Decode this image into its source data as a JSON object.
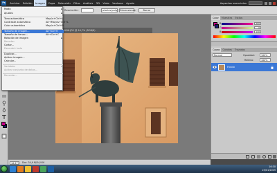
{
  "menubar": {
    "items": [
      "Archivo",
      "Edición",
      "Imagen",
      "Capa",
      "Selección",
      "Filtro",
      "Análisis",
      "3D",
      "Vista",
      "Ventana",
      "Ayuda"
    ],
    "active_item": "Imagen",
    "workspace_label": "Aspectos esenciales"
  },
  "options_bar": {
    "resolution_label": "Resolución:",
    "resolution_unit": "píxeles/pulgada",
    "front_image_button": "Dimensiones",
    "clear_button": "Borrar"
  },
  "document": {
    "tab_title": "P1000456.JPG @ 16,7% (RGB/8)"
  },
  "image_menu": {
    "items": [
      {
        "label": "Modo",
        "shortcut": "",
        "submenu": true,
        "disabled": false,
        "highlighted": false
      },
      {
        "label": "Ajustes",
        "shortcut": "",
        "submenu": true,
        "disabled": false,
        "highlighted": false
      },
      {
        "separator": true
      },
      {
        "label": "Tono automático",
        "shortcut": "Mayús+Ctrl+L",
        "disabled": false,
        "highlighted": false
      },
      {
        "label": "Contraste automático",
        "shortcut": "Alt+Mayús+Ctrl+L",
        "disabled": false,
        "highlighted": false
      },
      {
        "label": "Color automático",
        "shortcut": "Mayús+Ctrl+B",
        "disabled": false,
        "highlighted": false
      },
      {
        "separator": true
      },
      {
        "label": "Tamaño de imagen...",
        "shortcut": "Alt+Ctrl+I",
        "disabled": false,
        "highlighted": true
      },
      {
        "label": "Tamaño de lienzo...",
        "shortcut": "Alt+Ctrl+C",
        "disabled": false,
        "highlighted": false
      },
      {
        "label": "Rotación de imagen",
        "shortcut": "",
        "submenu": true,
        "disabled": false,
        "highlighted": false
      },
      {
        "label": "Recortar",
        "shortcut": "",
        "disabled": true,
        "highlighted": false
      },
      {
        "label": "Cortar...",
        "shortcut": "",
        "disabled": false,
        "highlighted": false
      },
      {
        "label": "Descubrir todo",
        "shortcut": "",
        "disabled": true,
        "highlighted": false
      },
      {
        "separator": true
      },
      {
        "label": "Duplicar...",
        "shortcut": "",
        "disabled": false,
        "highlighted": false
      },
      {
        "label": "Aplicar imagen...",
        "shortcut": "",
        "disabled": false,
        "highlighted": false
      },
      {
        "label": "Calcular...",
        "shortcut": "",
        "disabled": false,
        "highlighted": false
      },
      {
        "separator": true
      },
      {
        "label": "Variables",
        "shortcut": "",
        "submenu": true,
        "disabled": true,
        "highlighted": false
      },
      {
        "label": "Aplicar conjunto de datos...",
        "shortcut": "",
        "disabled": true,
        "highlighted": false
      },
      {
        "separator": true
      },
      {
        "label": "Reventar...",
        "shortcut": "",
        "disabled": true,
        "highlighted": false
      }
    ]
  },
  "color_panel": {
    "tabs": [
      "Color",
      "Muestras",
      "Estilos"
    ],
    "active_tab": "Color",
    "channels": [
      {
        "label": "R",
        "value": "200"
      },
      {
        "label": "G",
        "value": "0"
      },
      {
        "label": "B",
        "value": "140"
      }
    ]
  },
  "layers_panel": {
    "tabs": [
      "Capas",
      "Canales",
      "Trazados"
    ],
    "active_tab": "Capas",
    "blend_mode": "Normal",
    "opacity_label": "Opacidad:",
    "opacity_value": "100%",
    "fill_label": "Relleno:",
    "fill_value": "100%",
    "layer_name": "Fondo"
  },
  "status_bar": {
    "zoom": "16,67%",
    "doc_info": "Doc: 34,9 M/34,9 M"
  },
  "taskbar": {
    "time": "16:30",
    "date": "25/01/2009"
  },
  "colors": {
    "menubar_bg": "#2b2b2b",
    "highlight": "#3b78d6",
    "foreground_swatch": "#c8008c",
    "background_swatch": "#1b1b6b"
  }
}
